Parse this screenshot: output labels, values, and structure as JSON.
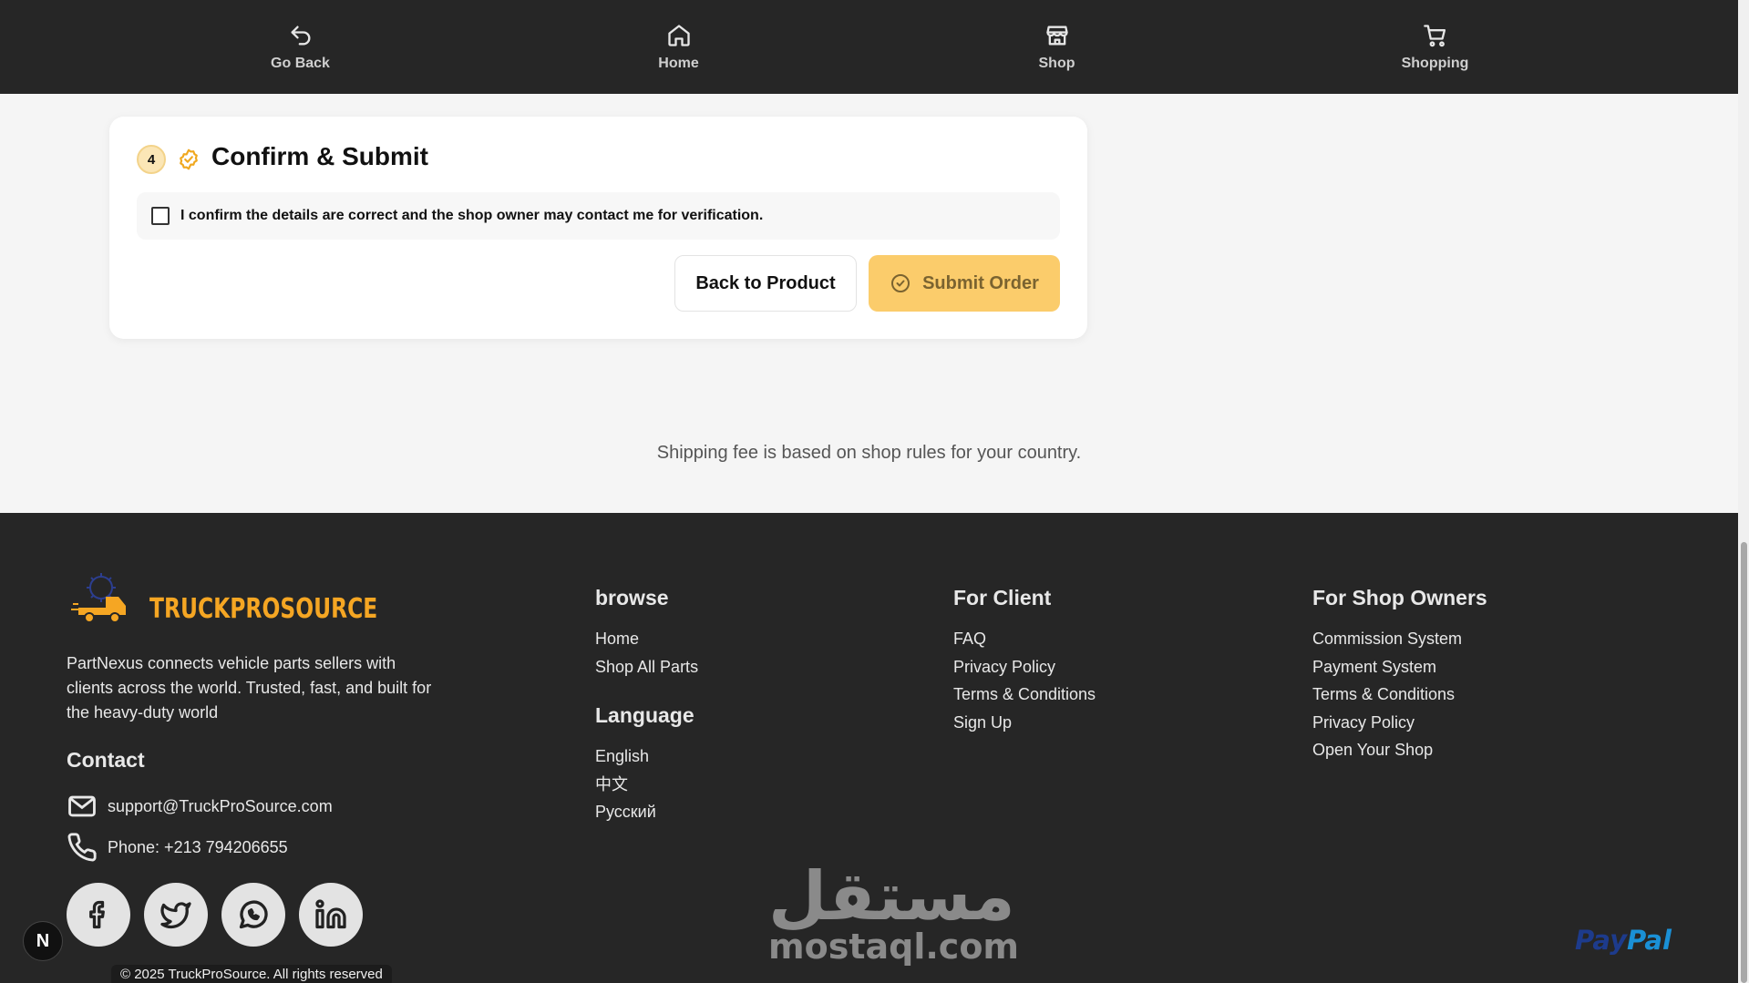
{
  "nav": {
    "items": [
      {
        "label": "Go Back",
        "icon": "undo-arrow-icon"
      },
      {
        "label": "Home",
        "icon": "home-icon"
      },
      {
        "label": "Shop",
        "icon": "store-icon"
      },
      {
        "label": "Shopping",
        "icon": "cart-icon"
      }
    ]
  },
  "card": {
    "step_number": "4",
    "title": "Confirm & Submit",
    "confirm_text": "I confirm the details are correct and the shop owner may contact me for verification.",
    "confirm_checked": false,
    "back_label": "Back to Product",
    "submit_label": "Submit Order"
  },
  "shipping_note": "Shipping fee is based on shop rules for your country.",
  "footer": {
    "brand": "TRUCKPROSOURCE",
    "about": "PartNexus connects vehicle parts sellers with clients across the world. Trusted, fast, and built for the heavy-duty world",
    "contact_heading": "Contact",
    "email": "support@TruckProSource.com",
    "phone": "Phone: +213 794206655",
    "socials": [
      "facebook-icon",
      "twitter-icon",
      "whatsapp-icon",
      "linkedin-icon"
    ],
    "browse": {
      "heading": "browse",
      "links": [
        "Home",
        "Shop All Parts"
      ]
    },
    "language": {
      "heading": "Language",
      "links": [
        "English",
        "中文",
        "Русский"
      ]
    },
    "client": {
      "heading": "For Client",
      "links": [
        "FAQ",
        "Privacy Policy",
        "Terms & Conditions",
        "Sign Up"
      ]
    },
    "owners": {
      "heading": "For Shop Owners",
      "links": [
        "Commission System",
        "Payment System",
        "Terms & Conditions",
        "Privacy Policy",
        "Open Your Shop"
      ]
    },
    "copyright": "© 2025 TruckProSource. All rights reserved",
    "watermark_ar": "مستقل",
    "watermark_latin": "mostaql.com",
    "paypal_a": "Pay",
    "paypal_b": "Pal"
  },
  "dev_badge": "N",
  "colors": {
    "accent": "#f5a623",
    "submit_bg": "#fbcc6b",
    "dark_bg": "#262626"
  }
}
